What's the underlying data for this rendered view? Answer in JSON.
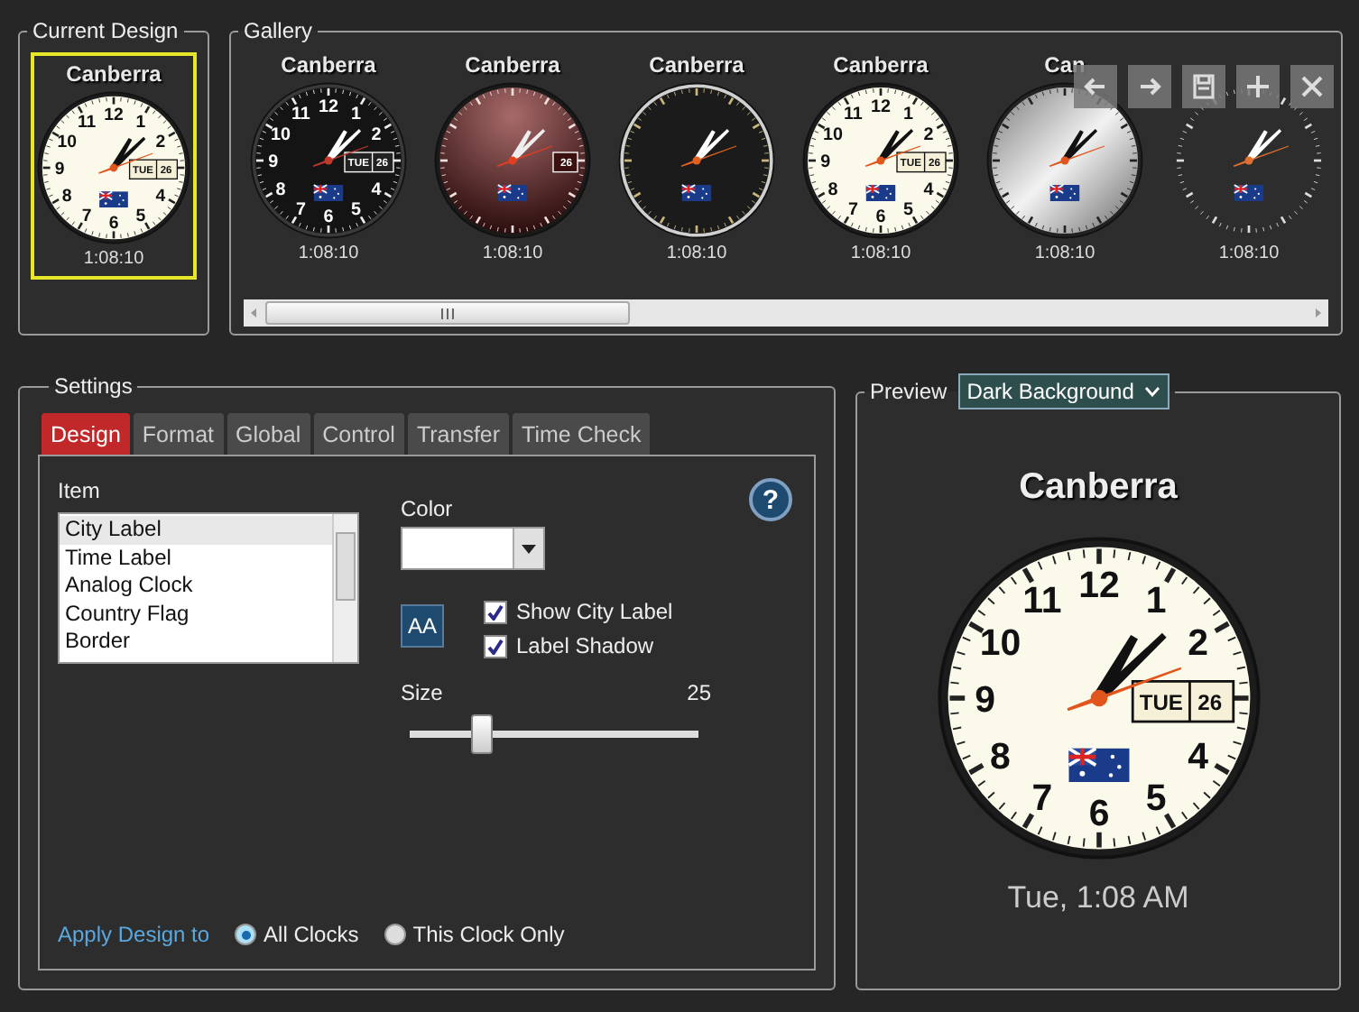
{
  "current_design": {
    "title": "Current Design",
    "clock": {
      "city": "Canberra",
      "time": "1:08:10",
      "kind": "classic",
      "selected": true,
      "numerals": [
        "11",
        "12",
        "1",
        "10",
        "2",
        "9",
        "8",
        "4",
        "7",
        "6",
        "5"
      ],
      "day": "TUE",
      "date": "26"
    }
  },
  "gallery": {
    "title": "Gallery",
    "clocks": [
      {
        "city": "Canberra",
        "time": "1:08:10",
        "kind": "dark",
        "numerals": [
          "11",
          "12",
          "1",
          "10",
          "2",
          "9",
          "8",
          "4",
          "7",
          "6",
          "5"
        ],
        "day": "TUE",
        "date": "26"
      },
      {
        "city": "Canberra",
        "time": "1:08:10",
        "kind": "maroon",
        "date": "26"
      },
      {
        "city": "Canberra",
        "time": "1:08:10",
        "kind": "chrome"
      },
      {
        "city": "Canberra",
        "time": "1:08:10",
        "kind": "classic",
        "numerals": [
          "11",
          "12",
          "1",
          "10",
          "2",
          "9",
          "8",
          "4",
          "7",
          "6",
          "5"
        ],
        "day": "TUE",
        "date": "26"
      },
      {
        "city": "Can",
        "time": "1:08:10",
        "kind": "silver"
      },
      {
        "time": "1:08:10",
        "kind": "minimal"
      }
    ]
  },
  "settings": {
    "title": "Settings",
    "tabs": [
      {
        "label": "Design",
        "selected": true
      },
      {
        "label": "Format",
        "selected": false
      },
      {
        "label": "Global",
        "selected": false
      },
      {
        "label": "Control",
        "selected": false
      },
      {
        "label": "Transfer",
        "selected": false
      },
      {
        "label": "Time Check",
        "selected": false
      }
    ],
    "item_label": "Item",
    "items": [
      {
        "label": "City Label",
        "selected": true
      },
      {
        "label": "Time Label",
        "selected": false
      },
      {
        "label": "Analog Clock",
        "selected": false
      },
      {
        "label": "Country Flag",
        "selected": false
      },
      {
        "label": "Border",
        "selected": false
      }
    ],
    "color_label": "Color",
    "font_button": "AA",
    "checkboxes": [
      {
        "label": "Show City Label",
        "checked": true
      },
      {
        "label": "Label Shadow",
        "checked": true
      }
    ],
    "size_label": "Size",
    "size_value": "25",
    "size_slider": {
      "level": 0.25
    },
    "help": "?",
    "apply_label": "Apply Design to",
    "apply_options": [
      {
        "label": "All Clocks",
        "selected": true
      },
      {
        "label": "This Clock Only",
        "selected": false
      }
    ]
  },
  "preview": {
    "title": "Preview",
    "background": "Dark Background",
    "clock": {
      "city": "Canberra",
      "kind": "classic",
      "numerals": [
        "11",
        "12",
        "1",
        "10",
        "2",
        "9",
        "8",
        "4",
        "7",
        "6",
        "5"
      ],
      "day": "TUE",
      "date": "26"
    },
    "time": "Tue, 1:08 AM"
  }
}
